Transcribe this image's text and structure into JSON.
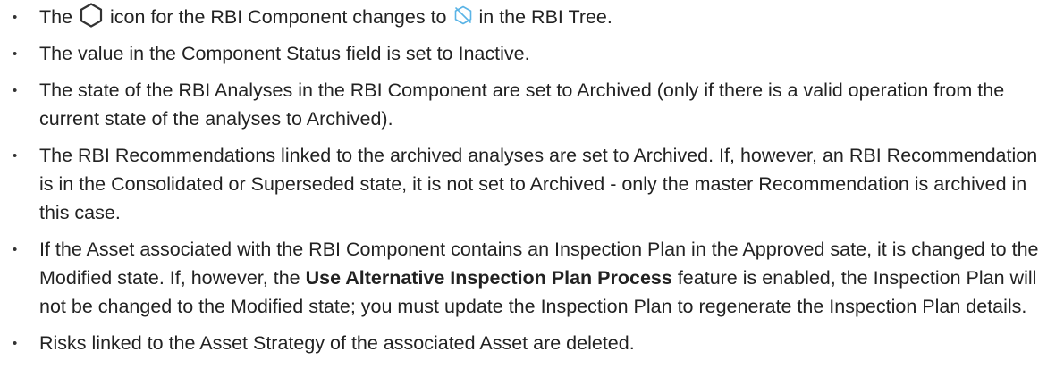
{
  "items": [
    {
      "text_before_icon": "The",
      "icon_before": "hexagon-outline-icon",
      "text_middle": "icon for the RBI Component changes to",
      "icon_after": "inactive-hexagon-icon",
      "text_after": "in the RBI Tree."
    },
    {
      "text": "The value in the Component Status field is set to Inactive."
    },
    {
      "text": "The state of the RBI Analyses in the RBI Component are set to Archived (only if there is a valid operation from the current state of the analyses to Archived)."
    },
    {
      "text": "The RBI Recommendations linked to the archived analyses are set to Archived. If, however, an RBI Recommendation is in the Consolidated or Superseded state, it is not set to Archived - only the master Recommendation is archived in this case."
    },
    {
      "text_before": "If the Asset associated with the RBI Component contains an Inspection Plan in the Approved sate, it is changed to the Modified state. If, however, the",
      "bold": "Use Alternative Inspection Plan Process",
      "text_after": "feature is enabled, the Inspection Plan will not be changed to the Modified state; you must update the Inspection Plan to regenerate the Inspection Plan details."
    },
    {
      "text": "Risks linked to the Asset Strategy of the associated Asset are deleted."
    }
  ],
  "colors": {
    "text": "#222222",
    "hexagon_outline": "#333333",
    "inactive_icon": "#5ab4e6"
  }
}
